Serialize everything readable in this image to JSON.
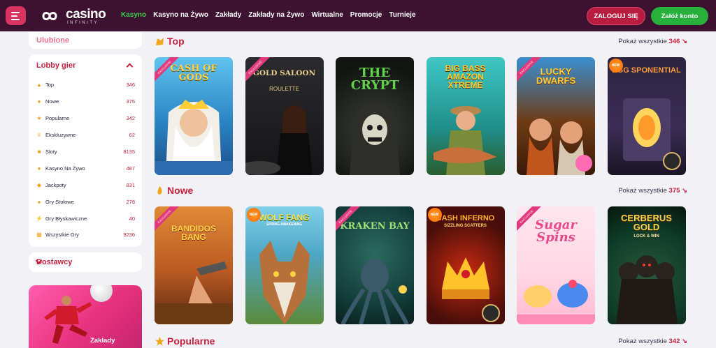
{
  "header": {
    "logo_main": "casino",
    "logo_sub": "INFINITY",
    "nav": [
      "Kasyno",
      "Kasyno na Żywo",
      "Zakłady",
      "Zakłady na Żywo",
      "Wirtualne",
      "Promocje",
      "Turnieje"
    ],
    "active_nav": "Kasyno",
    "login_label": "ZALOGUJ SIĘ",
    "register_label": "Załóż konto"
  },
  "sidebar": {
    "favorites_label": "Ulubione",
    "lobby_title": "Lobby gier",
    "lobby_items": [
      {
        "label": "Top",
        "count": "346",
        "icon": "fire-icon"
      },
      {
        "label": "Nowe",
        "count": "375",
        "icon": "flame-icon"
      },
      {
        "label": "Popularne",
        "count": "342",
        "icon": "star-icon"
      },
      {
        "label": "Ekskluzywne",
        "count": "62",
        "icon": "crown-icon"
      },
      {
        "label": "Sloty",
        "count": "8135",
        "icon": "slot-icon"
      },
      {
        "label": "Kasyno Na Żywo",
        "count": "487",
        "icon": "live-icon"
      },
      {
        "label": "Jackpoty",
        "count": "831",
        "icon": "jackpot-icon"
      },
      {
        "label": "Gry Stołowe",
        "count": "278",
        "icon": "table-icon"
      },
      {
        "label": "Gry Błyskawiczne",
        "count": "40",
        "icon": "lightning-icon"
      },
      {
        "label": "Wszystkie Gry",
        "count": "9236",
        "icon": "all-games-icon"
      }
    ],
    "providers_label": "Dostawcy",
    "promo_label": "Zakłady"
  },
  "sections": [
    {
      "title": "Top",
      "show_all": "Pokaż wszystkie",
      "count": "346",
      "games": [
        {
          "title": "CASH OF GODS",
          "badge": "EXCLUSIVE",
          "bg": "#3aa0d8",
          "accent": "#ffd24a"
        },
        {
          "title": "GOLD SALOON",
          "subtitle": "ROULETTE",
          "badge": "EXCLUSIVE",
          "bg": "#2b2a2c",
          "accent": "#d9b56a"
        },
        {
          "title": "THE CRYPT",
          "badge": "",
          "bg": "#1d1f1c",
          "accent": "#5fd14a"
        },
        {
          "title": "BIG BASS AMAZON XTREME",
          "badge": "",
          "bg": "#1f8f8a",
          "accent": "#ffcc22"
        },
        {
          "title": "LUCKY DWARFS",
          "badge": "EXCLUSIVE",
          "bg": "#6e3a14",
          "accent": "#ffcb30"
        },
        {
          "title": "EGG SPONENTIAL",
          "badge": "NEW",
          "bg": "#3a2d55",
          "accent": "#ff9a3a"
        }
      ]
    },
    {
      "title": "Nowe",
      "show_all": "Pokaż wszystkie",
      "count": "375",
      "games": [
        {
          "title": "BANDIDOS BANG",
          "badge": "EXCLUSIVE",
          "bg": "#b95a22",
          "accent": "#ffd34a"
        },
        {
          "title": "WOLF FANG",
          "subtitle": "SPRING AWAKENING",
          "badge": "NEW",
          "bg": "#4fa7c7",
          "accent": "#ffe14a"
        },
        {
          "title": "KRAKEN BAY",
          "badge": "EXCLUSIVE",
          "bg": "#14403c",
          "accent": "#9ee07a"
        },
        {
          "title": "CASH INFERNO",
          "subtitle": "SIZZLING SCATTERS",
          "badge": "NEW",
          "bg": "#4a0e0a",
          "accent": "#ffb02a"
        },
        {
          "title": "Sugar Spins",
          "badge": "EXCLUSIVE",
          "bg": "#ffd6e4",
          "accent": "#e84a8a"
        },
        {
          "title": "CERBERUS GOLD",
          "subtitle": "LOCK & WIN",
          "badge": "",
          "bg": "#0f3a2a",
          "accent": "#ffd04a"
        }
      ]
    },
    {
      "title": "Popularne",
      "show_all": "Pokaż wszystkie",
      "count": "342"
    }
  ],
  "colors": {
    "header_bg": "#3d1230",
    "accent_red": "#c5223f",
    "active_green": "#3fcf52",
    "register_green": "#27b03b"
  }
}
